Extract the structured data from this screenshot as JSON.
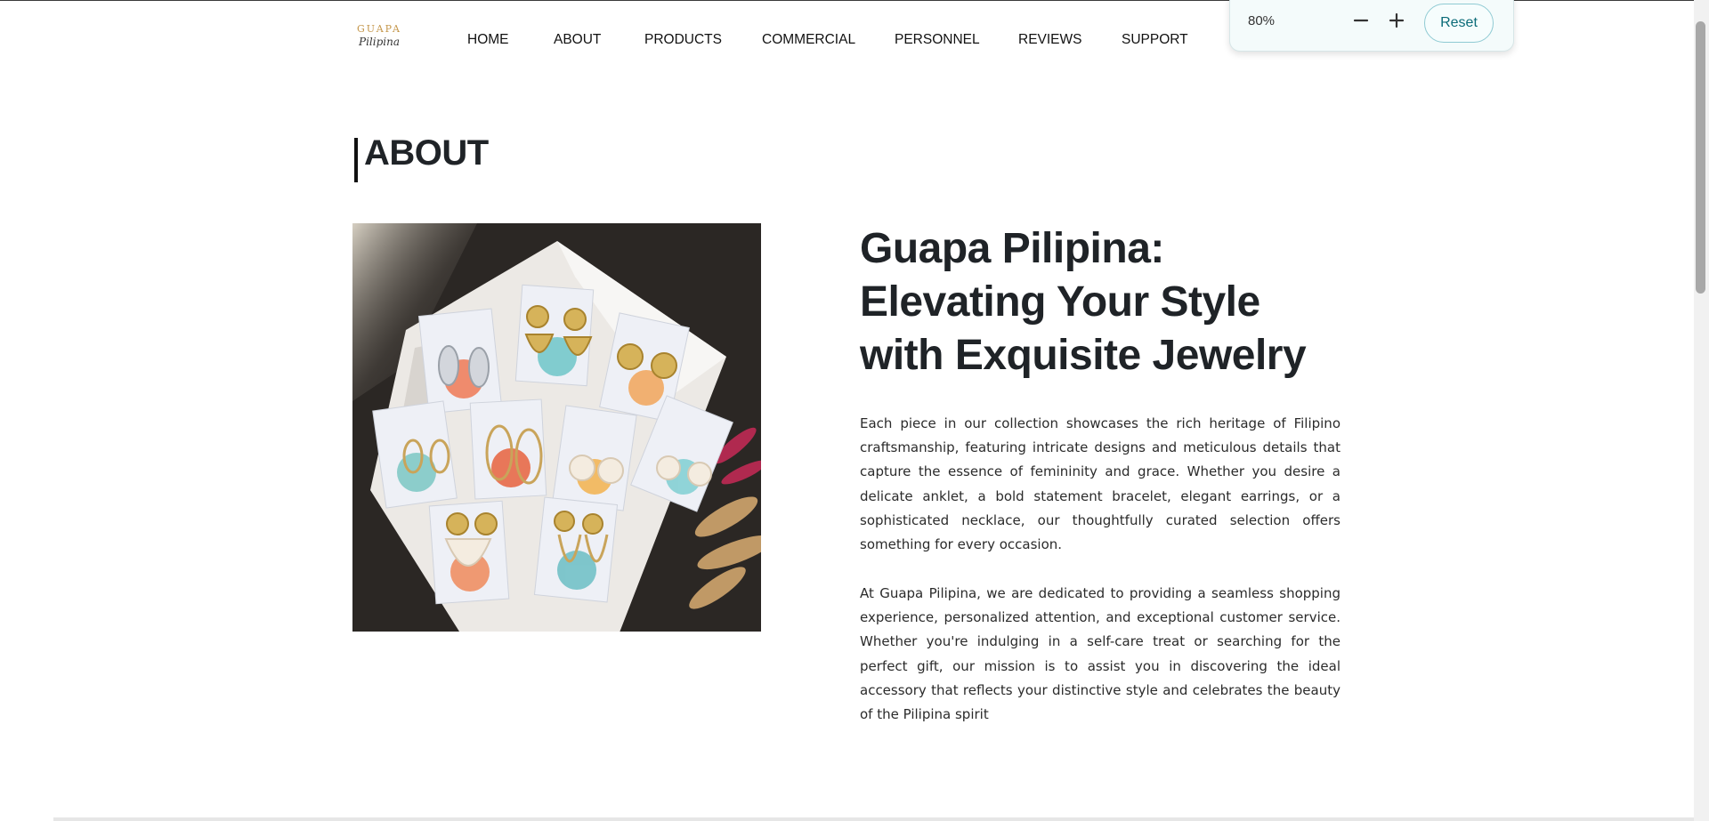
{
  "brand": {
    "logo_top": "GUAPA",
    "logo_bottom": "Pilipina"
  },
  "nav": {
    "items": [
      "HOME",
      "ABOUT",
      "PRODUCTS",
      "COMMERCIAL",
      "PERSONNEL",
      "REVIEWS",
      "SUPPORT"
    ]
  },
  "zoom": {
    "level": "80%",
    "decrease_icon": "minus-icon",
    "increase_icon": "plus-icon",
    "reset_label": "Reset"
  },
  "about": {
    "section_title": "ABOUT",
    "headline": "Guapa Pilipina: Elevating Your Style with Exquisite Jewelry",
    "paragraph_1": "Each piece in our collection showcases the rich heritage of Filipino craftsmanship, featuring intricate designs and meticulous details that capture the essence of femininity and grace. Whether you desire a delicate anklet, a bold statement bracelet, elegant earrings, or a sophisticated necklace, our thoughtfully curated selection offers something for every occasion.",
    "paragraph_2": "At Guapa Pilipina, we are dedicated to providing a seamless shopping experience, personalized attention, and exceptional customer service. Whether you're indulging in a self-care treat or searching for the perfect gift, our mission is to assist you in discovering the ideal accessory that reflects your distinctive style and celebrates the beauty of the Pilipina spirit"
  },
  "colors": {
    "logo_gold": "#c4964a",
    "reset_teal": "#0b6b78",
    "heading": "#1f2327"
  }
}
